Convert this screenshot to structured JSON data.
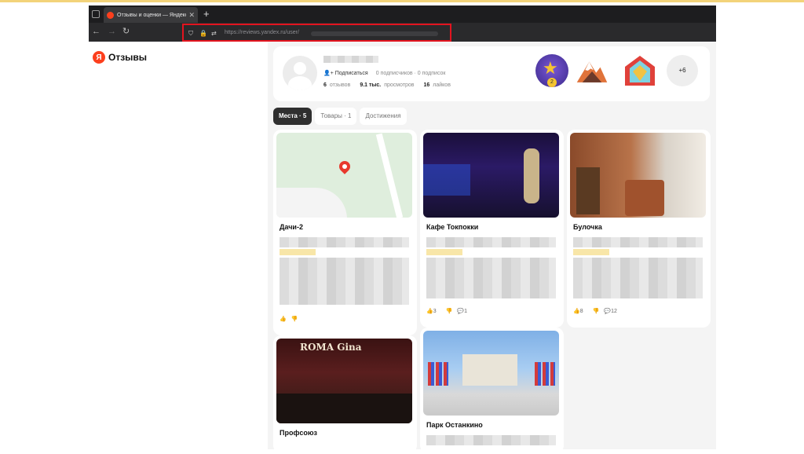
{
  "browser": {
    "tab_title": "Отзывы и оценки — Яндекс",
    "url": "https://reviews.yandex.ru/user/"
  },
  "sidebar": {
    "logo_letter": "Я",
    "logo_text": "Отзывы"
  },
  "profile": {
    "subscribe_label": "Подписаться",
    "followers_info": "0 подписчиков · 0 подписок",
    "stats": [
      {
        "value": "6",
        "label": "отзывов"
      },
      {
        "value": "9.1 тыс.",
        "label": "просмотров"
      },
      {
        "value": "16",
        "label": "лайков"
      }
    ],
    "badge_count": "2",
    "more_badges": "+6"
  },
  "tabs": [
    {
      "label": "Места · 5",
      "active": true
    },
    {
      "label": "Товары · 1",
      "active": false
    },
    {
      "label": "Достижения",
      "active": false
    }
  ],
  "cards": [
    {
      "title": "Дачи-2",
      "likes": "",
      "dislikes": "",
      "comments": ""
    },
    {
      "title": "Кафе Токпокки",
      "likes": "3",
      "dislikes": "",
      "comments": "1"
    },
    {
      "title": "Булочка",
      "likes": "8",
      "dislikes": "",
      "comments": "12"
    },
    {
      "title": "Профсоюз",
      "sign_text": "ROMA Gina"
    },
    {
      "title": "Парк Останкино"
    }
  ]
}
